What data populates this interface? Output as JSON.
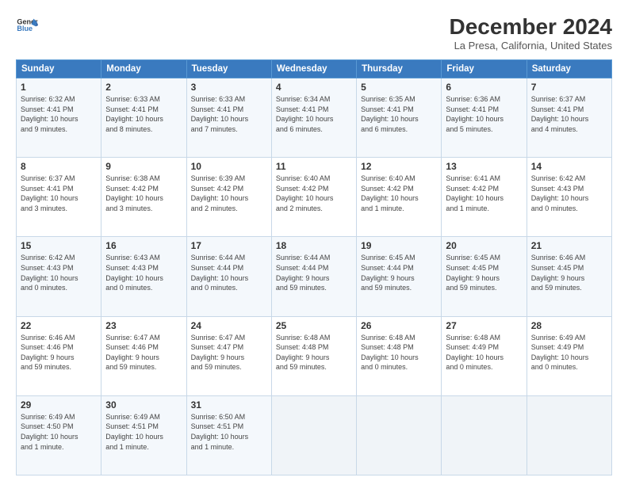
{
  "header": {
    "logo_line1": "General",
    "logo_line2": "Blue",
    "month": "December 2024",
    "location": "La Presa, California, United States"
  },
  "days_of_week": [
    "Sunday",
    "Monday",
    "Tuesday",
    "Wednesday",
    "Thursday",
    "Friday",
    "Saturday"
  ],
  "weeks": [
    [
      {
        "day": 1,
        "info": "Sunrise: 6:32 AM\nSunset: 4:41 PM\nDaylight: 10 hours\nand 9 minutes."
      },
      {
        "day": 2,
        "info": "Sunrise: 6:33 AM\nSunset: 4:41 PM\nDaylight: 10 hours\nand 8 minutes."
      },
      {
        "day": 3,
        "info": "Sunrise: 6:33 AM\nSunset: 4:41 PM\nDaylight: 10 hours\nand 7 minutes."
      },
      {
        "day": 4,
        "info": "Sunrise: 6:34 AM\nSunset: 4:41 PM\nDaylight: 10 hours\nand 6 minutes."
      },
      {
        "day": 5,
        "info": "Sunrise: 6:35 AM\nSunset: 4:41 PM\nDaylight: 10 hours\nand 6 minutes."
      },
      {
        "day": 6,
        "info": "Sunrise: 6:36 AM\nSunset: 4:41 PM\nDaylight: 10 hours\nand 5 minutes."
      },
      {
        "day": 7,
        "info": "Sunrise: 6:37 AM\nSunset: 4:41 PM\nDaylight: 10 hours\nand 4 minutes."
      }
    ],
    [
      {
        "day": 8,
        "info": "Sunrise: 6:37 AM\nSunset: 4:41 PM\nDaylight: 10 hours\nand 3 minutes."
      },
      {
        "day": 9,
        "info": "Sunrise: 6:38 AM\nSunset: 4:42 PM\nDaylight: 10 hours\nand 3 minutes."
      },
      {
        "day": 10,
        "info": "Sunrise: 6:39 AM\nSunset: 4:42 PM\nDaylight: 10 hours\nand 2 minutes."
      },
      {
        "day": 11,
        "info": "Sunrise: 6:40 AM\nSunset: 4:42 PM\nDaylight: 10 hours\nand 2 minutes."
      },
      {
        "day": 12,
        "info": "Sunrise: 6:40 AM\nSunset: 4:42 PM\nDaylight: 10 hours\nand 1 minute."
      },
      {
        "day": 13,
        "info": "Sunrise: 6:41 AM\nSunset: 4:42 PM\nDaylight: 10 hours\nand 1 minute."
      },
      {
        "day": 14,
        "info": "Sunrise: 6:42 AM\nSunset: 4:43 PM\nDaylight: 10 hours\nand 0 minutes."
      }
    ],
    [
      {
        "day": 15,
        "info": "Sunrise: 6:42 AM\nSunset: 4:43 PM\nDaylight: 10 hours\nand 0 minutes."
      },
      {
        "day": 16,
        "info": "Sunrise: 6:43 AM\nSunset: 4:43 PM\nDaylight: 10 hours\nand 0 minutes."
      },
      {
        "day": 17,
        "info": "Sunrise: 6:44 AM\nSunset: 4:44 PM\nDaylight: 10 hours\nand 0 minutes."
      },
      {
        "day": 18,
        "info": "Sunrise: 6:44 AM\nSunset: 4:44 PM\nDaylight: 9 hours\nand 59 minutes."
      },
      {
        "day": 19,
        "info": "Sunrise: 6:45 AM\nSunset: 4:44 PM\nDaylight: 9 hours\nand 59 minutes."
      },
      {
        "day": 20,
        "info": "Sunrise: 6:45 AM\nSunset: 4:45 PM\nDaylight: 9 hours\nand 59 minutes."
      },
      {
        "day": 21,
        "info": "Sunrise: 6:46 AM\nSunset: 4:45 PM\nDaylight: 9 hours\nand 59 minutes."
      }
    ],
    [
      {
        "day": 22,
        "info": "Sunrise: 6:46 AM\nSunset: 4:46 PM\nDaylight: 9 hours\nand 59 minutes."
      },
      {
        "day": 23,
        "info": "Sunrise: 6:47 AM\nSunset: 4:46 PM\nDaylight: 9 hours\nand 59 minutes."
      },
      {
        "day": 24,
        "info": "Sunrise: 6:47 AM\nSunset: 4:47 PM\nDaylight: 9 hours\nand 59 minutes."
      },
      {
        "day": 25,
        "info": "Sunrise: 6:48 AM\nSunset: 4:48 PM\nDaylight: 9 hours\nand 59 minutes."
      },
      {
        "day": 26,
        "info": "Sunrise: 6:48 AM\nSunset: 4:48 PM\nDaylight: 10 hours\nand 0 minutes."
      },
      {
        "day": 27,
        "info": "Sunrise: 6:48 AM\nSunset: 4:49 PM\nDaylight: 10 hours\nand 0 minutes."
      },
      {
        "day": 28,
        "info": "Sunrise: 6:49 AM\nSunset: 4:49 PM\nDaylight: 10 hours\nand 0 minutes."
      }
    ],
    [
      {
        "day": 29,
        "info": "Sunrise: 6:49 AM\nSunset: 4:50 PM\nDaylight: 10 hours\nand 1 minute."
      },
      {
        "day": 30,
        "info": "Sunrise: 6:49 AM\nSunset: 4:51 PM\nDaylight: 10 hours\nand 1 minute."
      },
      {
        "day": 31,
        "info": "Sunrise: 6:50 AM\nSunset: 4:51 PM\nDaylight: 10 hours\nand 1 minute."
      },
      null,
      null,
      null,
      null
    ]
  ]
}
